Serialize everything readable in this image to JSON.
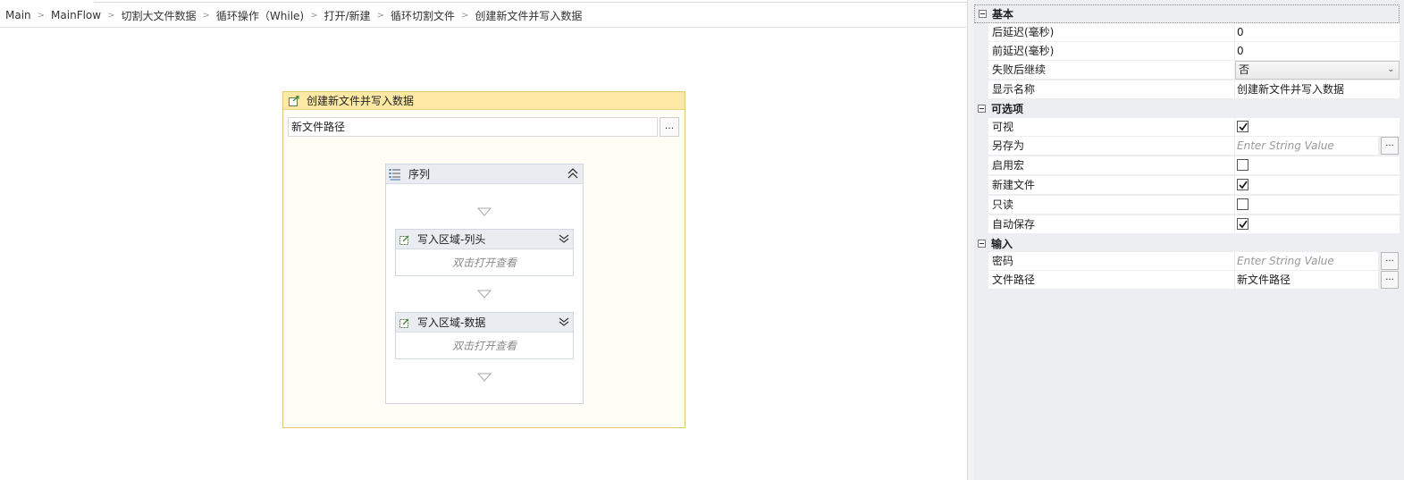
{
  "breadcrumb": [
    "Main",
    "MainFlow",
    "切割大文件数据",
    "循环操作（While)",
    "打开/新建",
    "循环切割文件",
    "创建新文件并写入数据"
  ],
  "activity": {
    "title": "创建新文件并写入数据",
    "path_value": "新文件路径",
    "path_button": "...",
    "sequence": {
      "title": "序列",
      "items": [
        {
          "title": "写入区域-列头",
          "body": "双击打开查看"
        },
        {
          "title": "写入区域-数据",
          "body": "双击打开查看"
        }
      ]
    }
  },
  "props": {
    "basic": {
      "label": "基本",
      "delay_after_label": "后延迟(毫秒)",
      "delay_after_value": "0",
      "delay_before_label": "前延迟(毫秒)",
      "delay_before_value": "0",
      "continue_on_error_label": "失败后继续",
      "continue_on_error_value": "否",
      "display_name_label": "显示名称",
      "display_name_value": "创建新文件并写入数据"
    },
    "options": {
      "label": "可选项",
      "visible_label": "可视",
      "visible_checked": true,
      "save_as_label": "另存为",
      "save_as_placeholder": "Enter String Value",
      "enable_macro_label": "启用宏",
      "enable_macro_checked": false,
      "new_file_label": "新建文件",
      "new_file_checked": true,
      "read_only_label": "只读",
      "read_only_checked": false,
      "auto_save_label": "自动保存",
      "auto_save_checked": true
    },
    "input": {
      "label": "输入",
      "password_label": "密码",
      "password_placeholder": "Enter String Value",
      "file_path_label": "文件路径",
      "file_path_value": "新文件路径"
    },
    "dots_label": "..."
  }
}
